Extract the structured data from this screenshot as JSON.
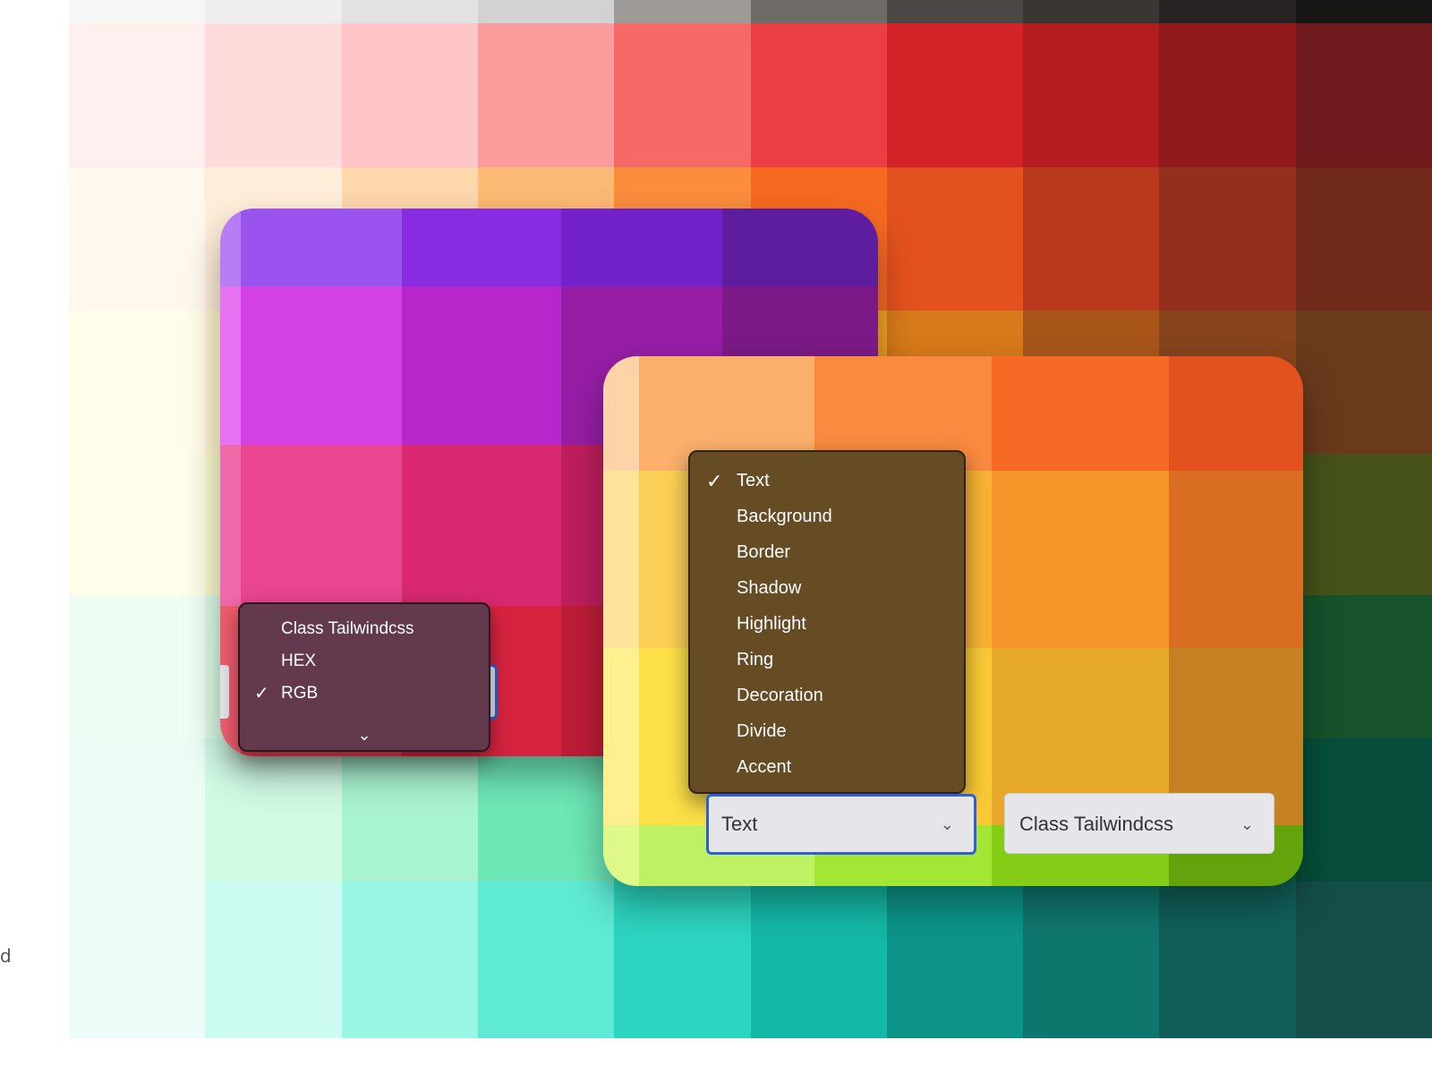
{
  "edge_text": "d",
  "background_palette": {
    "rows": [
      [
        "#f6f6f6",
        "#eeeeee",
        "#e2e2e2",
        "#d2d2d2",
        "#9e9a97",
        "#6e6a67",
        "#4b4745",
        "#3a3634",
        "#252221",
        "#181515"
      ],
      [
        "#fff0ef",
        "#fedcdc",
        "#fdc5c5",
        "#fb9d9d",
        "#f66969",
        "#ec3f45",
        "#d42327",
        "#b41c1f",
        "#92191b",
        "#6f1a1c"
      ],
      [
        "#fff8ef",
        "#ffeed9",
        "#fed8ab",
        "#fdba74",
        "#fb8d3d",
        "#f76a21",
        "#e2511f",
        "#b8391c",
        "#932f1c",
        "#6f2a1a"
      ],
      [
        "#fffcea",
        "#fff6cf",
        "#fdeda6",
        "#fbdb67",
        "#f6c133",
        "#efa51f",
        "#d77a1b",
        "#a8551a",
        "#86431c",
        "#6a3a1c"
      ],
      [
        "#fdfde9",
        "#fbfbcd",
        "#f3f6a6",
        "#e7ec6f",
        "#d1dc3e",
        "#b3c624",
        "#8ea31a",
        "#6d7f19",
        "#566519",
        "#45521a"
      ],
      [
        "#f0fdf4",
        "#dcfce7",
        "#b9f8d0",
        "#83efac",
        "#4ede81",
        "#23c45e",
        "#17a34a",
        "#16803c",
        "#176534",
        "#16532d"
      ],
      [
        "#edfdf6",
        "#d1fae5",
        "#a8f3d0",
        "#6ee7b7",
        "#34d399",
        "#10b981",
        "#059669",
        "#047857",
        "#065f46",
        "#064e3b"
      ],
      [
        "#effdfa",
        "#ccfbf1",
        "#99f6e4",
        "#5eead4",
        "#2dd4bf",
        "#14b8a6",
        "#0d9488",
        "#0f766e",
        "#115e59",
        "#134e4a"
      ]
    ],
    "row_heights": [
      26,
      161,
      160,
      160,
      158,
      160,
      160,
      175
    ]
  },
  "card_violet": {
    "rows": [
      [
        "#b77df3",
        "#9b53ef",
        "#882ce2",
        "#7321cb",
        "#5e1d9e"
      ],
      [
        "#e472f1",
        "#d341e5",
        "#b626ca",
        "#961ea5",
        "#7b1a86"
      ],
      [
        "#ef6aa8",
        "#e94590",
        "#d82870",
        "#be1e5c",
        "#9f1b4d"
      ],
      [
        "#f05d6e",
        "#e83b52",
        "#d82340",
        "#bd1d37",
        "#9d1b30"
      ]
    ]
  },
  "card_amber": {
    "rows": [
      [
        "#fdd4a8",
        "#fbb06b",
        "#f98a3f",
        "#f76a26",
        "#e2521f"
      ],
      [
        "#fee39b",
        "#fbcf55",
        "#f8b234",
        "#f5952a",
        "#d96d21"
      ],
      [
        "#fef08f",
        "#fde047",
        "#f9c935",
        "#e6a92b",
        "#c68222"
      ],
      [
        "#def98a",
        "#bef264",
        "#a3e635",
        "#84cc16",
        "#65a30d"
      ]
    ]
  },
  "format_menu": {
    "items": [
      {
        "label": "Class Tailwindcss",
        "checked": false
      },
      {
        "label": "HEX",
        "checked": false
      },
      {
        "label": "RGB",
        "checked": true
      }
    ],
    "check_glyph": "✓",
    "scroll_glyph": "⌄"
  },
  "type_menu": {
    "items": [
      {
        "label": "Text",
        "checked": true
      },
      {
        "label": "Background",
        "checked": false
      },
      {
        "label": "Border",
        "checked": false
      },
      {
        "label": "Shadow",
        "checked": false
      },
      {
        "label": "Highlight",
        "checked": false
      },
      {
        "label": "Ring",
        "checked": false
      },
      {
        "label": "Decoration",
        "checked": false
      },
      {
        "label": "Divide",
        "checked": false
      },
      {
        "label": "Accent",
        "checked": false
      }
    ],
    "check_glyph": "✓"
  },
  "type_select": {
    "value": "Text",
    "chevron": "⌄"
  },
  "format_select": {
    "value": "Class Tailwindcss",
    "chevron": "⌄"
  }
}
